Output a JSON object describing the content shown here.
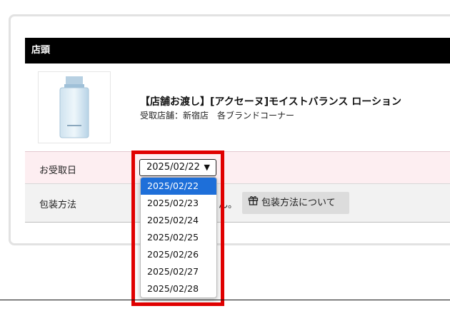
{
  "section": {
    "header": "店頭"
  },
  "product": {
    "image_icon": "lotion-bottle-image",
    "name": "【店舗お渡し】[アクセーヌ]モイストバランス ローション",
    "store_info": "受取店舗：新宿店　各ブランドコーナー"
  },
  "pickup_date": {
    "label": "お受取日",
    "selected": "2025/02/22",
    "arrow": "▼",
    "options": [
      "2025/02/22",
      "2025/02/23",
      "2025/02/24",
      "2025/02/25",
      "2025/02/26",
      "2025/02/27",
      "2025/02/28"
    ]
  },
  "wrapping": {
    "label": "包装方法",
    "note_fragment": "ん。",
    "button_label": "包装方法について",
    "button_icon": "gift-icon"
  },
  "colors": {
    "header_bg": "#000000",
    "date_row_bg": "#fdeef1",
    "wrap_row_bg": "#f2f2f2",
    "selected_option": "#1e6fd9",
    "highlight": "#e00000"
  }
}
